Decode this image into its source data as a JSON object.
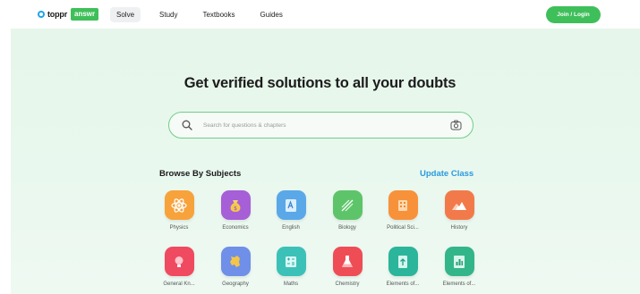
{
  "header": {
    "logo_text": "toppr",
    "logo_badge": "answr",
    "nav": [
      "Solve",
      "Study",
      "Textbooks",
      "Guides"
    ],
    "login_label": "Join / Login"
  },
  "hero": {
    "headline": "Get verified solutions to all your doubts",
    "search_placeholder": "Search for questions & chapters"
  },
  "browse": {
    "title": "Browse By Subjects",
    "update_label": "Update Class"
  },
  "subjects": [
    {
      "label": "Physics",
      "color": "#f7a23b",
      "icon": "atom-icon"
    },
    {
      "label": "Economics",
      "color": "#a65fd6",
      "icon": "money-bag-icon"
    },
    {
      "label": "English",
      "color": "#5aa8e8",
      "icon": "book-letter-icon"
    },
    {
      "label": "Biology",
      "color": "#5ec46a",
      "icon": "dna-icon"
    },
    {
      "label": "Political Sci...",
      "color": "#f7923b",
      "icon": "building-icon"
    },
    {
      "label": "History",
      "color": "#f27a4a",
      "icon": "mountain-icon"
    },
    {
      "label": "General Kn...",
      "color": "#ef4a5f",
      "icon": "bulb-icon"
    },
    {
      "label": "Geography",
      "color": "#6f8fe8",
      "icon": "map-icon"
    },
    {
      "label": "Maths",
      "color": "#3cc1b8",
      "icon": "calculator-icon"
    },
    {
      "label": "Chemistry",
      "color": "#ef4d56",
      "icon": "flask-icon"
    },
    {
      "label": "Elements of...",
      "color": "#2bb59a",
      "icon": "upload-book-icon"
    },
    {
      "label": "Elements of...",
      "color": "#33b58a",
      "icon": "chart-book-icon"
    }
  ]
}
